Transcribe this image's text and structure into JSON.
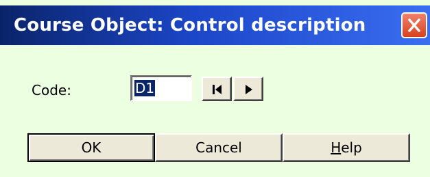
{
  "window": {
    "title": "Course Object: Control description",
    "close_label": "close"
  },
  "form": {
    "code_label": "Code:",
    "code_value": "D1"
  },
  "navigation": {
    "first_icon": "first-record-icon",
    "next_icon": "next-record-icon"
  },
  "buttons": {
    "ok_label": "OK",
    "cancel_label": "Cancel",
    "help_mnemonic": "H",
    "help_rest": "elp"
  },
  "colors": {
    "titlebar_start": "#0a246a",
    "titlebar_end": "#3a6df0",
    "close_button": "#d8411e",
    "dialog_background": "#ecffe0",
    "selection": "#0a246a"
  }
}
